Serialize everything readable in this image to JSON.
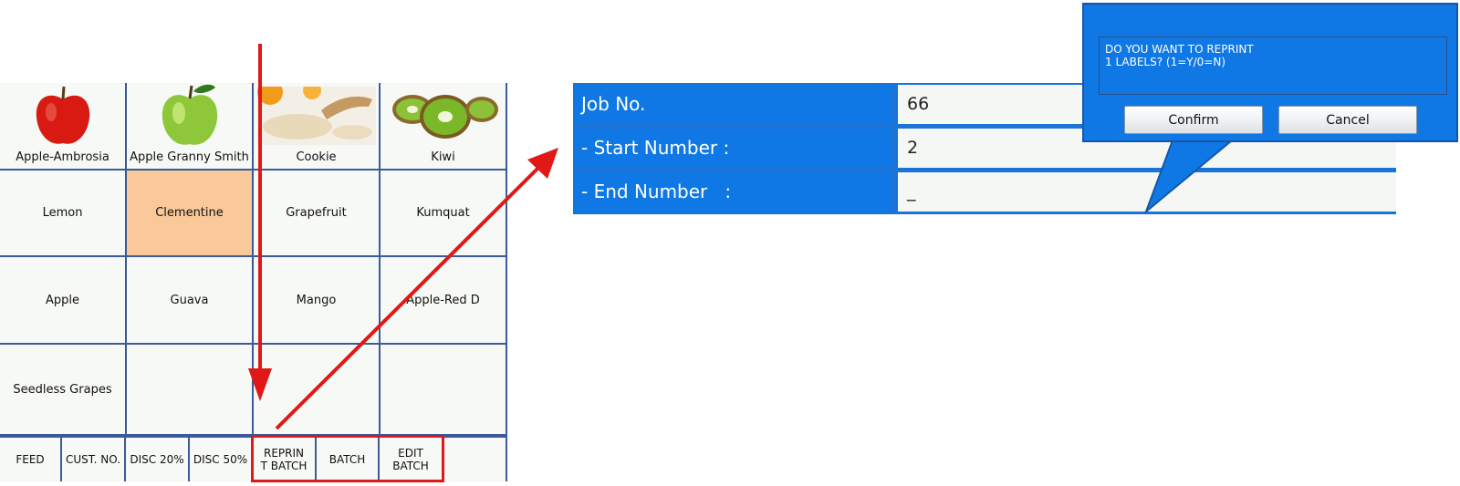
{
  "products": [
    {
      "label": "Apple-Ambrosia",
      "icon": "red-apple-icon"
    },
    {
      "label": "Apple Granny Smith",
      "icon": "green-apple-icon"
    },
    {
      "label": "Cookie",
      "icon": "cookie-ingredients-image"
    },
    {
      "label": "Kiwi",
      "icon": "kiwi-icon"
    },
    {
      "label": "Lemon"
    },
    {
      "label": "Clementine",
      "selected": true
    },
    {
      "label": "Grapefruit"
    },
    {
      "label": "Kumquat"
    },
    {
      "label": "Apple"
    },
    {
      "label": "Guava"
    },
    {
      "label": "Mango"
    },
    {
      "label": "Apple-Red D"
    },
    {
      "label": "Seedless Grapes"
    },
    {
      "label": ""
    },
    {
      "label": ""
    },
    {
      "label": ""
    }
  ],
  "functions": {
    "feed": "FEED",
    "cust_no": "CUST. NO.",
    "disc20": "DISC 20%",
    "disc50": "DISC 50%",
    "reprint_batch": "REPRIN\nT BATCH",
    "batch": "BATCH",
    "edit_batch": "EDIT\nBATCH"
  },
  "job_panel": {
    "job_no_label": "Job No.",
    "job_no_value": "66",
    "start_label": "- Start Number :",
    "start_value": "2",
    "end_label": "- End Number   :",
    "end_value": "_"
  },
  "dialog": {
    "message": "DO YOU WANT TO REPRINT\n1 LABELS? (1=Y/0=N)",
    "confirm": "Confirm",
    "cancel": "Cancel"
  },
  "colors": {
    "panel_blue": "#0f78e4",
    "highlight_red": "#e01818",
    "selected_cell": "#f9c99a"
  }
}
